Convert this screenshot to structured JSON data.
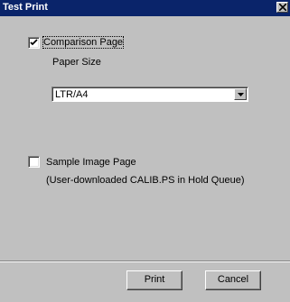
{
  "window": {
    "title": "Test Print"
  },
  "comparison": {
    "label": "Comparison Page",
    "checked": true
  },
  "paper_size": {
    "label": "Paper Size",
    "selected": "LTR/A4"
  },
  "sample": {
    "label": "Sample Image Page",
    "note": "(User-downloaded CALIB.PS in Hold Queue)",
    "checked": false
  },
  "buttons": {
    "print": "Print",
    "cancel": "Cancel"
  }
}
